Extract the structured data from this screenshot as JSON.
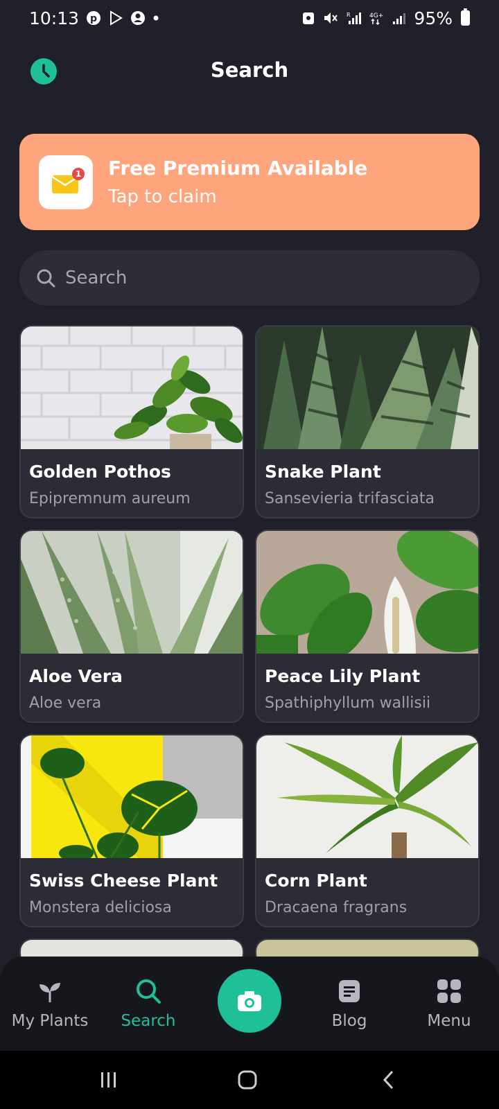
{
  "status_bar": {
    "time": "10:13",
    "battery": "95%"
  },
  "header": {
    "title": "Search"
  },
  "premium_banner": {
    "title": "Free Premium Available",
    "subtitle": "Tap to claim",
    "badge_count": "1",
    "background_color": "#fea57d"
  },
  "search": {
    "placeholder": "Search"
  },
  "plants": [
    {
      "name": "Golden Pothos",
      "latin": "Epipremnum aureum"
    },
    {
      "name": "Snake Plant",
      "latin": "Sansevieria trifasciata"
    },
    {
      "name": "Aloe Vera",
      "latin": "Aloe vera"
    },
    {
      "name": "Peace Lily Plant",
      "latin": "Spathiphyllum wallisii"
    },
    {
      "name": "Swiss Cheese Plant",
      "latin": "Monstera deliciosa"
    },
    {
      "name": "Corn Plant",
      "latin": "Dracaena fragrans"
    }
  ],
  "bottom_nav": {
    "items": [
      {
        "label": "My Plants",
        "icon": "sprout-icon",
        "active": false
      },
      {
        "label": "Search",
        "icon": "search-icon",
        "active": true
      },
      {
        "label": "",
        "icon": "camera-icon",
        "active": false
      },
      {
        "label": "Blog",
        "icon": "document-icon",
        "active": false
      },
      {
        "label": "Menu",
        "icon": "grid-icon",
        "active": false
      }
    ]
  },
  "colors": {
    "accent": "#1fbf98",
    "background": "#1f2029",
    "card": "#2b2c35"
  }
}
